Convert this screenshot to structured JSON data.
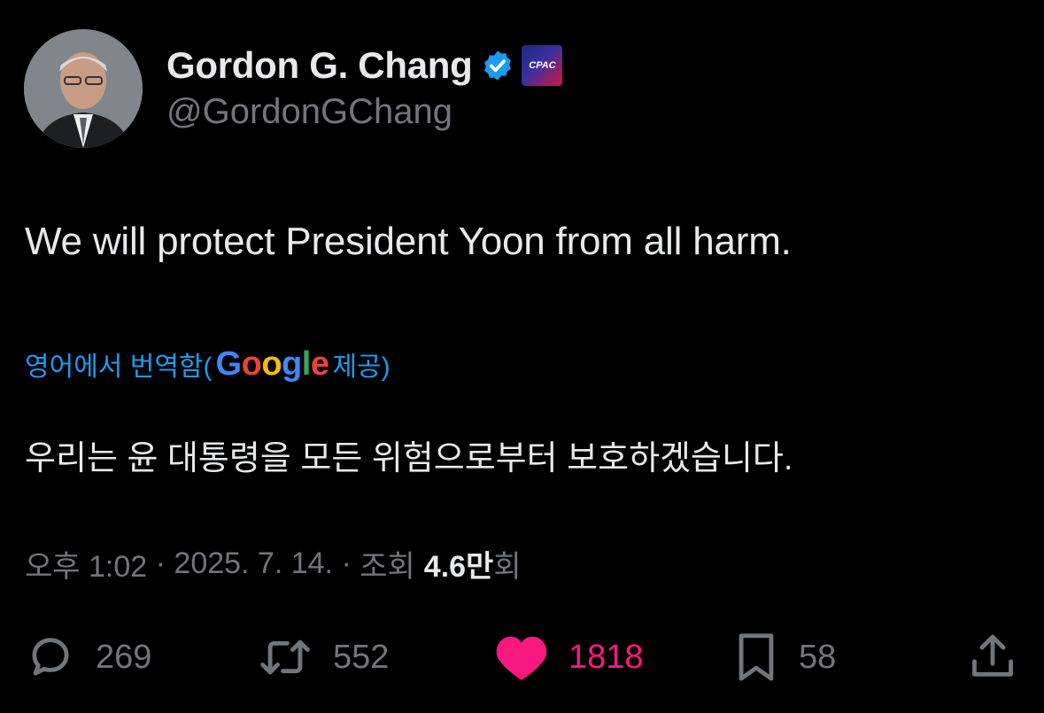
{
  "author": {
    "name": "Gordon G. Chang",
    "handle": "@GordonGChang",
    "badge_text": "CPAC",
    "verified_icon": "verified-badge-icon",
    "verified_color": "#1d9bf0"
  },
  "tweet": {
    "text": "We will protect President Yoon from all harm."
  },
  "translation": {
    "prefix": "영어에서 번역함(",
    "google_letters": [
      "G",
      "o",
      "o",
      "g",
      "l",
      "e"
    ],
    "suffix": " 제공)",
    "text": "우리는 윤 대통령을 모든 위험으로부터 보호하겠습니다."
  },
  "meta": {
    "time": "오후 1:02",
    "date": "2025. 7. 14.",
    "views_label": "조회",
    "views_count": "4.6만",
    "views_suffix": "회",
    "separator": " · "
  },
  "actions": {
    "replies": "269",
    "reposts": "552",
    "likes": "1818",
    "bookmarks": "58"
  },
  "colors": {
    "background": "#000000",
    "text": "#e7e9ea",
    "secondary": "#71767b",
    "link": "#1d9bf0",
    "like": "#f91880"
  }
}
